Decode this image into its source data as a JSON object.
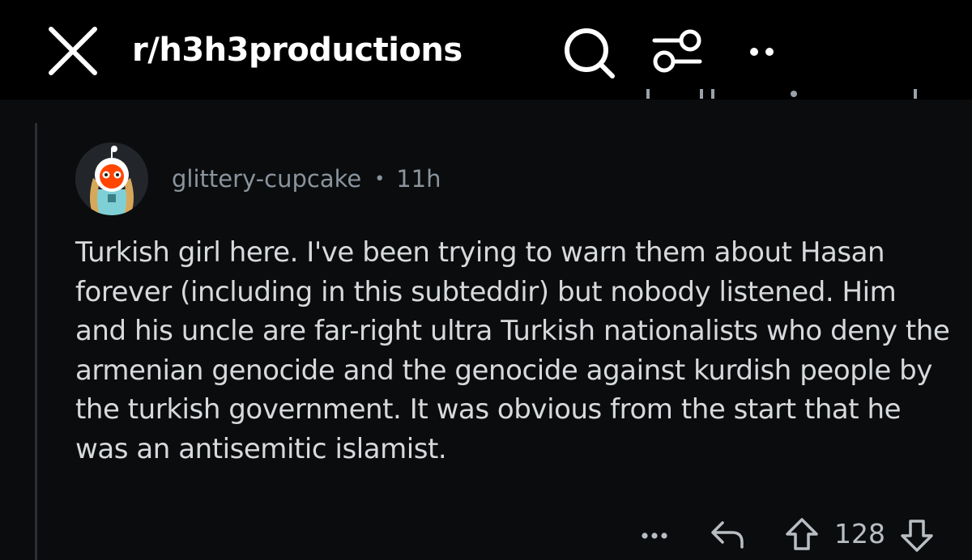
{
  "header": {
    "subreddit": "r/h3h3productions",
    "icons": {
      "close": "close-icon",
      "search": "search-icon",
      "filter": "filter-sliders-icon",
      "more": "more-dots-icon"
    }
  },
  "comment": {
    "avatar": "user-avatar",
    "username": "glittery-cupcake",
    "separator": "•",
    "age": "11h",
    "body": "Turkish girl here. I've been trying to warn them about Hasan forever (including in this subteddir) but nobody listened. Him and his uncle are far-right ultra Turkish nationalists who deny the armenian genocide and the genocide against kurdish people by the turkish government. It was obvious from the start that he was an antisemitic islamist.",
    "actions": {
      "more": "more-options-icon",
      "reply": "reply-icon",
      "upvote": "upvote-icon",
      "score": "128",
      "downvote": "downvote-icon"
    }
  },
  "colors": {
    "background": "#0b0c0e",
    "topbar": "#000000",
    "text": "#d7dadc",
    "meta": "#8a949d",
    "avatar_accent": "#ff4500"
  }
}
